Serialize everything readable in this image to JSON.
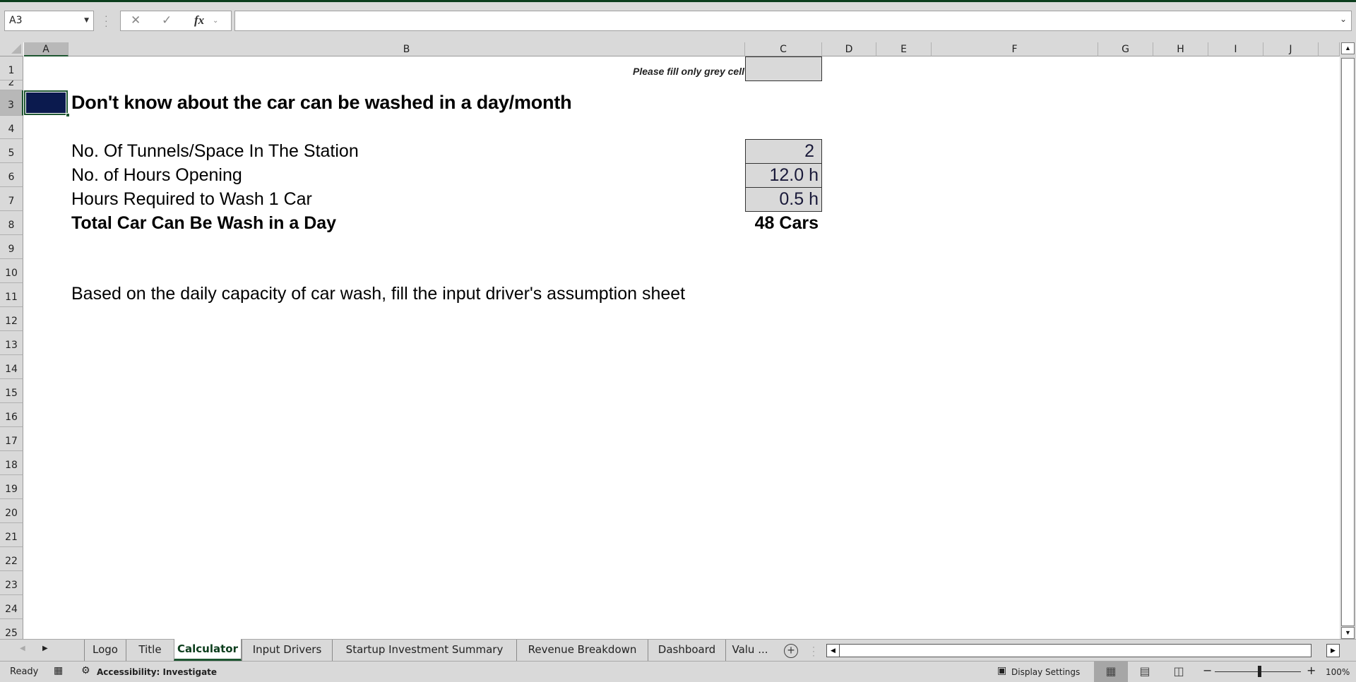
{
  "formula_bar": {
    "name_box": "A3",
    "cancel_icon": "✕",
    "enter_icon": "✓",
    "fx_label": "fx",
    "formula": ""
  },
  "columns": [
    "A",
    "B",
    "C",
    "D",
    "E",
    "F",
    "G",
    "H",
    "I",
    "J"
  ],
  "rows": [
    "1",
    "2",
    "3",
    "4",
    "5",
    "6",
    "7",
    "8",
    "9",
    "10",
    "11",
    "12",
    "13",
    "14",
    "15",
    "16",
    "17",
    "18",
    "19",
    "20",
    "21",
    "22",
    "23",
    "24",
    "25"
  ],
  "sheet": {
    "note": "Please fill only grey cell",
    "title": "Don't know about the car can be washed in a day/month",
    "inputs": [
      {
        "label": "No. Of Tunnels/Space In The Station",
        "value": "2"
      },
      {
        "label": "No. of Hours Opening",
        "value": "12.0 h"
      },
      {
        "label": "Hours Required to Wash 1 Car",
        "value": "0.5 h"
      }
    ],
    "total": {
      "label": "Total Car Can Be Wash in a Day",
      "value": "48 Cars"
    },
    "footnote": "Based on the daily capacity of car wash, fill the input driver's assumption sheet",
    "input_fill_color": "#d9d9d9",
    "value_color": "#1a1a3a",
    "selected_fill_color": "#0b1a4e"
  },
  "tabs": [
    {
      "label": "Logo",
      "active": false
    },
    {
      "label": "Title",
      "active": false
    },
    {
      "label": "Calculator",
      "active": true
    },
    {
      "label": "Input Drivers",
      "active": false
    },
    {
      "label": "Startup Investment Summary",
      "active": false
    },
    {
      "label": "Revenue Breakdown",
      "active": false
    },
    {
      "label": "Dashboard",
      "active": false
    },
    {
      "label": "Valu ...",
      "active": false
    }
  ],
  "status": {
    "ready": "Ready",
    "accessibility": "Accessibility: Investigate",
    "display_settings": "Display Settings",
    "zoom_minus": "−",
    "zoom_plus": "+",
    "zoom_level": "100%"
  }
}
